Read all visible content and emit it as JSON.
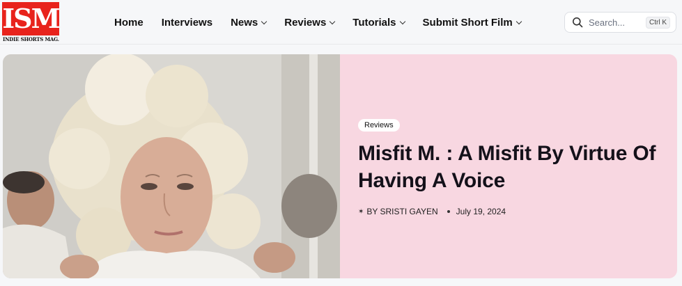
{
  "logo": {
    "mark": "ISM",
    "tagline": "INDIE SHORTS MAG."
  },
  "nav": {
    "items": [
      {
        "label": "Home"
      },
      {
        "label": "Interviews"
      },
      {
        "label": "News"
      },
      {
        "label": "Reviews"
      },
      {
        "label": "Tutorials"
      },
      {
        "label": "Submit Short Film"
      }
    ]
  },
  "search": {
    "placeholder": "Search...",
    "shortcut": "Ctrl K"
  },
  "hero": {
    "category": "Reviews",
    "title": "Misfit M. : A Misfit By Virtue Of Having A Voice",
    "author": "BY SRISTI GAYEN",
    "date": "July 19, 2024",
    "image_icon": "film-still-image"
  },
  "colors": {
    "brand_red": "#e8231c",
    "hero_background": "#f8d7e1",
    "page_background": "#f6f7f9"
  }
}
